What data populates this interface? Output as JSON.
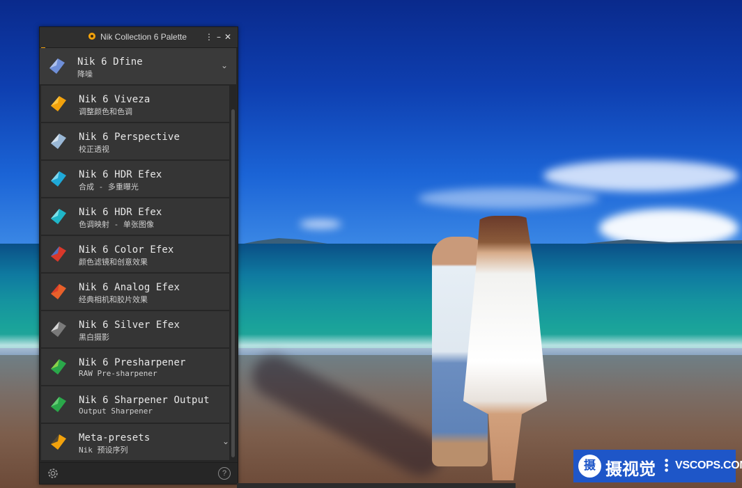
{
  "palette": {
    "title": "Nik Collection 6 Palette",
    "menu_glyph": "⋮",
    "minimize_glyph": "–",
    "close_glyph": "✕",
    "items": [
      {
        "name": "Nik 6 Dfine",
        "sub": "降噪",
        "icon": "dfine-icon",
        "colors": [
          "#6f8fd8",
          "#b9c9f0"
        ]
      },
      {
        "name": "Nik 6 Viveza",
        "sub": "调整颜色和色调",
        "icon": "viveza-icon",
        "colors": [
          "#f2a20c",
          "#ffcc4d"
        ]
      },
      {
        "name": "Nik 6 Perspective",
        "sub": "校正透视",
        "icon": "perspective-icon",
        "colors": [
          "#9ab8d6",
          "#dfe9f2"
        ]
      },
      {
        "name": "Nik 6 HDR Efex",
        "sub": "合成 - 多重曝光",
        "icon": "hdr-efex-merge-icon",
        "colors": [
          "#1fa9d8",
          "#8fe0f5"
        ]
      },
      {
        "name": "Nik 6 HDR Efex",
        "sub": "色调映射 - 单张图像",
        "icon": "hdr-efex-tonemap-icon",
        "colors": [
          "#1fb6c8",
          "#8ce8ef"
        ]
      },
      {
        "name": "Nik 6 Color Efex",
        "sub": "颜色滤镜和创意效果",
        "icon": "color-efex-icon",
        "colors": [
          "#d9382a",
          "#3a7ad9"
        ]
      },
      {
        "name": "Nik 6 Analog Efex",
        "sub": "经典相机和胶片效果",
        "icon": "analog-efex-icon",
        "colors": [
          "#e8602a",
          "#d93a2a"
        ]
      },
      {
        "name": "Nik 6 Silver Efex",
        "sub": "黑白摄影",
        "icon": "silver-efex-icon",
        "colors": [
          "#7a7a7a",
          "#e6e6e6"
        ]
      },
      {
        "name": "Nik 6 Presharpener",
        "sub": "RAW Pre-sharpener",
        "icon": "presharpener-icon",
        "colors": [
          "#2aa84a",
          "#9ad94a"
        ]
      },
      {
        "name": "Nik 6 Sharpener Output",
        "sub": "Output Sharpener",
        "icon": "sharpener-output-icon",
        "colors": [
          "#2aa84a",
          "#6fd47a"
        ]
      },
      {
        "name": "Meta-presets",
        "sub": "Nik 预设序列",
        "icon": "meta-presets-icon",
        "colors": [
          "#f2a20c",
          "#3a3a3a"
        ]
      }
    ],
    "help_glyph": "?"
  },
  "watermark": {
    "logo_char": "摄",
    "cn_text": "摄视觉",
    "en_text": "VSCOPS.COM"
  },
  "colors": {
    "accent": "#f2a20c",
    "panel_bg": "#262626",
    "item_bg": "#353535",
    "badge_bg": "#1e56c8"
  }
}
